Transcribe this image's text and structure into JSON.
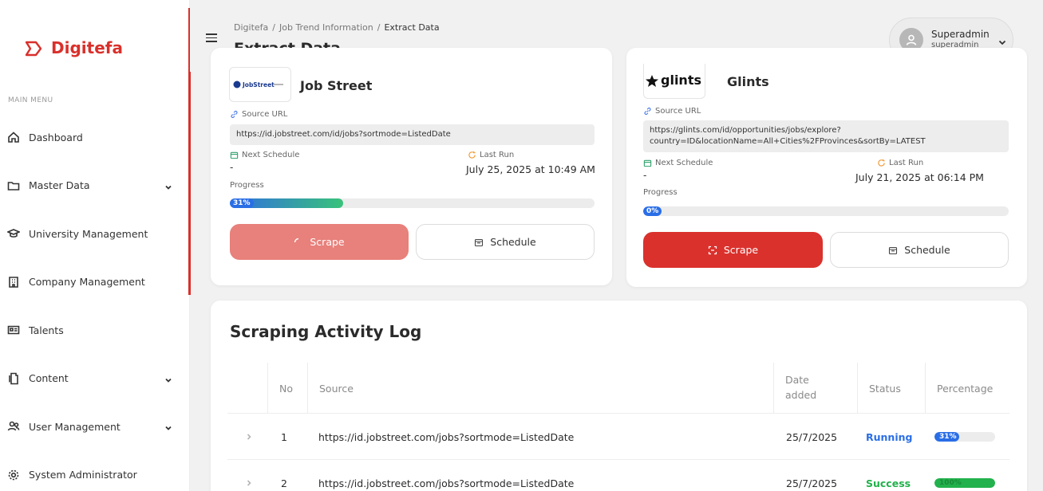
{
  "brand": {
    "name": "Digitefa",
    "color": "#d9302b"
  },
  "sidebar": {
    "menu_title": "MAIN MENU",
    "items": [
      {
        "label": "Dashboard",
        "icon": "home-icon",
        "has_chevron": false
      },
      {
        "label": "Master Data",
        "icon": "folder-icon",
        "has_chevron": true
      },
      {
        "label": "University Management",
        "icon": "graduation-cap-icon",
        "has_chevron": false
      },
      {
        "label": "Company Management",
        "icon": "building-icon",
        "has_chevron": false
      },
      {
        "label": "Talents",
        "icon": "id-card-icon",
        "has_chevron": false
      },
      {
        "label": "Content",
        "icon": "document-icon",
        "has_chevron": true
      },
      {
        "label": "User Management",
        "icon": "users-icon",
        "has_chevron": true
      },
      {
        "label": "System Administrator",
        "icon": "gear-icon",
        "has_chevron": false
      }
    ]
  },
  "header": {
    "breadcrumb": [
      "Digitefa",
      "Job Trend Information",
      "Extract Data"
    ],
    "separator": "/",
    "title": "Extract Data",
    "user": {
      "name": "Superadmin",
      "role": "superadmin"
    }
  },
  "sources": [
    {
      "name": "Job Street",
      "logo_text": "JobStreet",
      "source_url_label": "Source URL",
      "url": "https://id.jobstreet.com/id/jobs?sortmode=ListedDate",
      "next_schedule_label": "Next Schedule",
      "next_schedule": "-",
      "last_run_label": "Last Run",
      "last_run": "July 25, 2025 at 10:49 AM",
      "progress_label": "Progress",
      "progress_text": "31%",
      "progress": 0.31,
      "scrape_label": "Scrape",
      "schedule_label": "Schedule"
    },
    {
      "name": "Glints",
      "logo_text": "glints",
      "source_url_label": "Source URL",
      "url_line1": "https://glints.com/id/opportunities/jobs/explore?",
      "url_line2": "country=ID&locationName=All+Cities%2FProvinces&sortBy=LATEST",
      "next_schedule_label": "Next Schedule",
      "next_schedule": "-",
      "last_run_label": "Last Run",
      "last_run": "July 21, 2025 at 06:14 PM",
      "progress_label": "Progress",
      "progress_text": "0%",
      "progress": 0,
      "scrape_label": "Scrape",
      "schedule_label": "Schedule"
    }
  ],
  "log": {
    "title": "Scraping Activity Log",
    "columns": {
      "no": "No",
      "source": "Source",
      "date_line1": "Date",
      "date_line2": "added",
      "status": "Status",
      "percentage": "Percentage"
    },
    "rows": [
      {
        "no": "1",
        "source": "https://id.jobstreet.com/jobs?sortmode=ListedDate",
        "date": "25/7/2025",
        "status": "Running",
        "percentage_text": "31%",
        "percentage": 0.31
      },
      {
        "no": "2",
        "source": "https://id.jobstreet.com/jobs?sortmode=ListedDate",
        "date": "25/7/2025",
        "status": "Success",
        "percentage_text": "100%",
        "percentage": 1.0
      }
    ]
  },
  "colors": {
    "primary": "#da312c",
    "primary_disabled": "#e8807b",
    "running": "#2a6ee6",
    "success": "#22b14c"
  }
}
